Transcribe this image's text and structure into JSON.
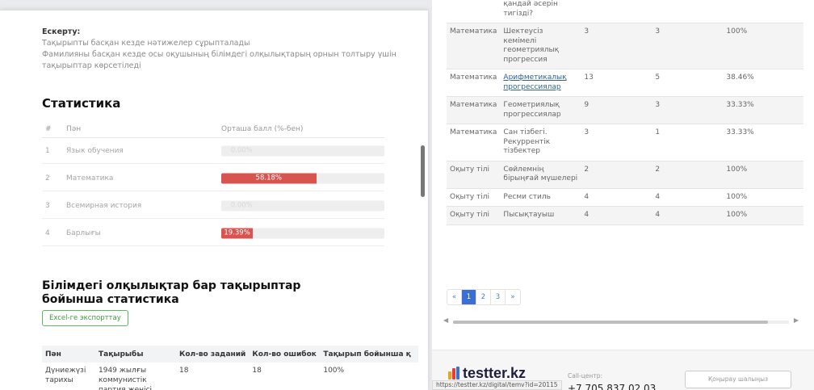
{
  "note": {
    "title": "Ескерту:",
    "lines": [
      "Тақырыпты басқан кезде нәтижелер сұрыпталады",
      "Фамилияны басқан кезде осы оқушының білімдегі олқылықтарың орнын толтыру үшін тақырыптар көрсетіледі"
    ]
  },
  "stats": {
    "title": "Статистика",
    "headers": {
      "num": "#",
      "subject": "Пән",
      "score": "Орташа балл (%-бен)"
    },
    "rows": [
      {
        "num": "1",
        "subject": "Язык обучения",
        "value_label": "0.00%",
        "percent": 0,
        "faint": true
      },
      {
        "num": "2",
        "subject": "Математика",
        "value_label": "58.18%",
        "percent": 58.18,
        "faint": false
      },
      {
        "num": "3",
        "subject": "Всемирная история",
        "value_label": "0.00%",
        "percent": 0,
        "faint": true
      },
      {
        "num": "4",
        "subject": "Барлығы",
        "value_label": "19.39%",
        "percent": 19.39,
        "faint": false
      }
    ]
  },
  "gaps": {
    "title": "Білімдегі олқылықтар бар тақырыптар бойынша статистика",
    "export_label": "Excel-ге экспорттау",
    "headers": [
      "Пән",
      "Тақырыбы",
      "Кол-во заданий",
      "Кол-во ошибок",
      "Тақырып бойынша қ"
    ],
    "first_row": {
      "subject": "Дүниежүзі тарихы",
      "topic": "1949 жылғы коммунистік партия жеңісі",
      "tasks": "18",
      "errors": "18",
      "percent": "100%"
    }
  },
  "right_table": {
    "rows": [
      {
        "subject": "",
        "topic": "қандай әсерін тигізді?",
        "tasks": "",
        "errors": "",
        "percent": "",
        "pct_color": "red",
        "underline": false
      },
      {
        "subject": "Математика",
        "topic": "Шектеусіз кемімелі геометриялық прогрессия",
        "tasks": "3",
        "errors": "3",
        "percent": "100%",
        "pct_color": "red",
        "underline": false
      },
      {
        "subject": "Математика",
        "topic": "Арифметикалық прогрессиялар",
        "tasks": "13",
        "errors": "5",
        "percent": "38.46%",
        "pct_color": "green",
        "underline": true
      },
      {
        "subject": "Математика",
        "topic": "Геометриялық прогрессиялар",
        "tasks": "9",
        "errors": "3",
        "percent": "33.33%",
        "pct_color": "green",
        "underline": false
      },
      {
        "subject": "Математика",
        "topic": "Сан тізбегі. Рекуррентік тізбектер",
        "tasks": "3",
        "errors": "1",
        "percent": "33.33%",
        "pct_color": "green",
        "underline": false
      },
      {
        "subject": "Оқыту тілі",
        "topic": "Сөйлемнің бірыңғай мүшелері",
        "tasks": "2",
        "errors": "2",
        "percent": "100%",
        "pct_color": "red",
        "underline": false
      },
      {
        "subject": "Оқыту тілі",
        "topic": "Ресми стиль",
        "tasks": "4",
        "errors": "4",
        "percent": "100%",
        "pct_color": "red",
        "underline": false
      },
      {
        "subject": "Оқыту тілі",
        "topic": "Пысықтауыш",
        "tasks": "4",
        "errors": "4",
        "percent": "100%",
        "pct_color": "red",
        "underline": false
      }
    ]
  },
  "pagination": {
    "prev": "«",
    "pages": [
      "1",
      "2",
      "3"
    ],
    "active": "1",
    "next": "»"
  },
  "footer": {
    "logo": "testter.kz",
    "call_center_label": "Call-центр:",
    "phone": "+7 705 837 02 03",
    "call_button": "Қоңырау шалыңыз"
  },
  "status_url": "https://testter.kz/digital/temv?id=20115",
  "colors": {
    "bar_red": "#d9534f",
    "link_blue": "#4a7fc1",
    "green": "#3c9b3c",
    "active_page": "#3b6fd6"
  }
}
